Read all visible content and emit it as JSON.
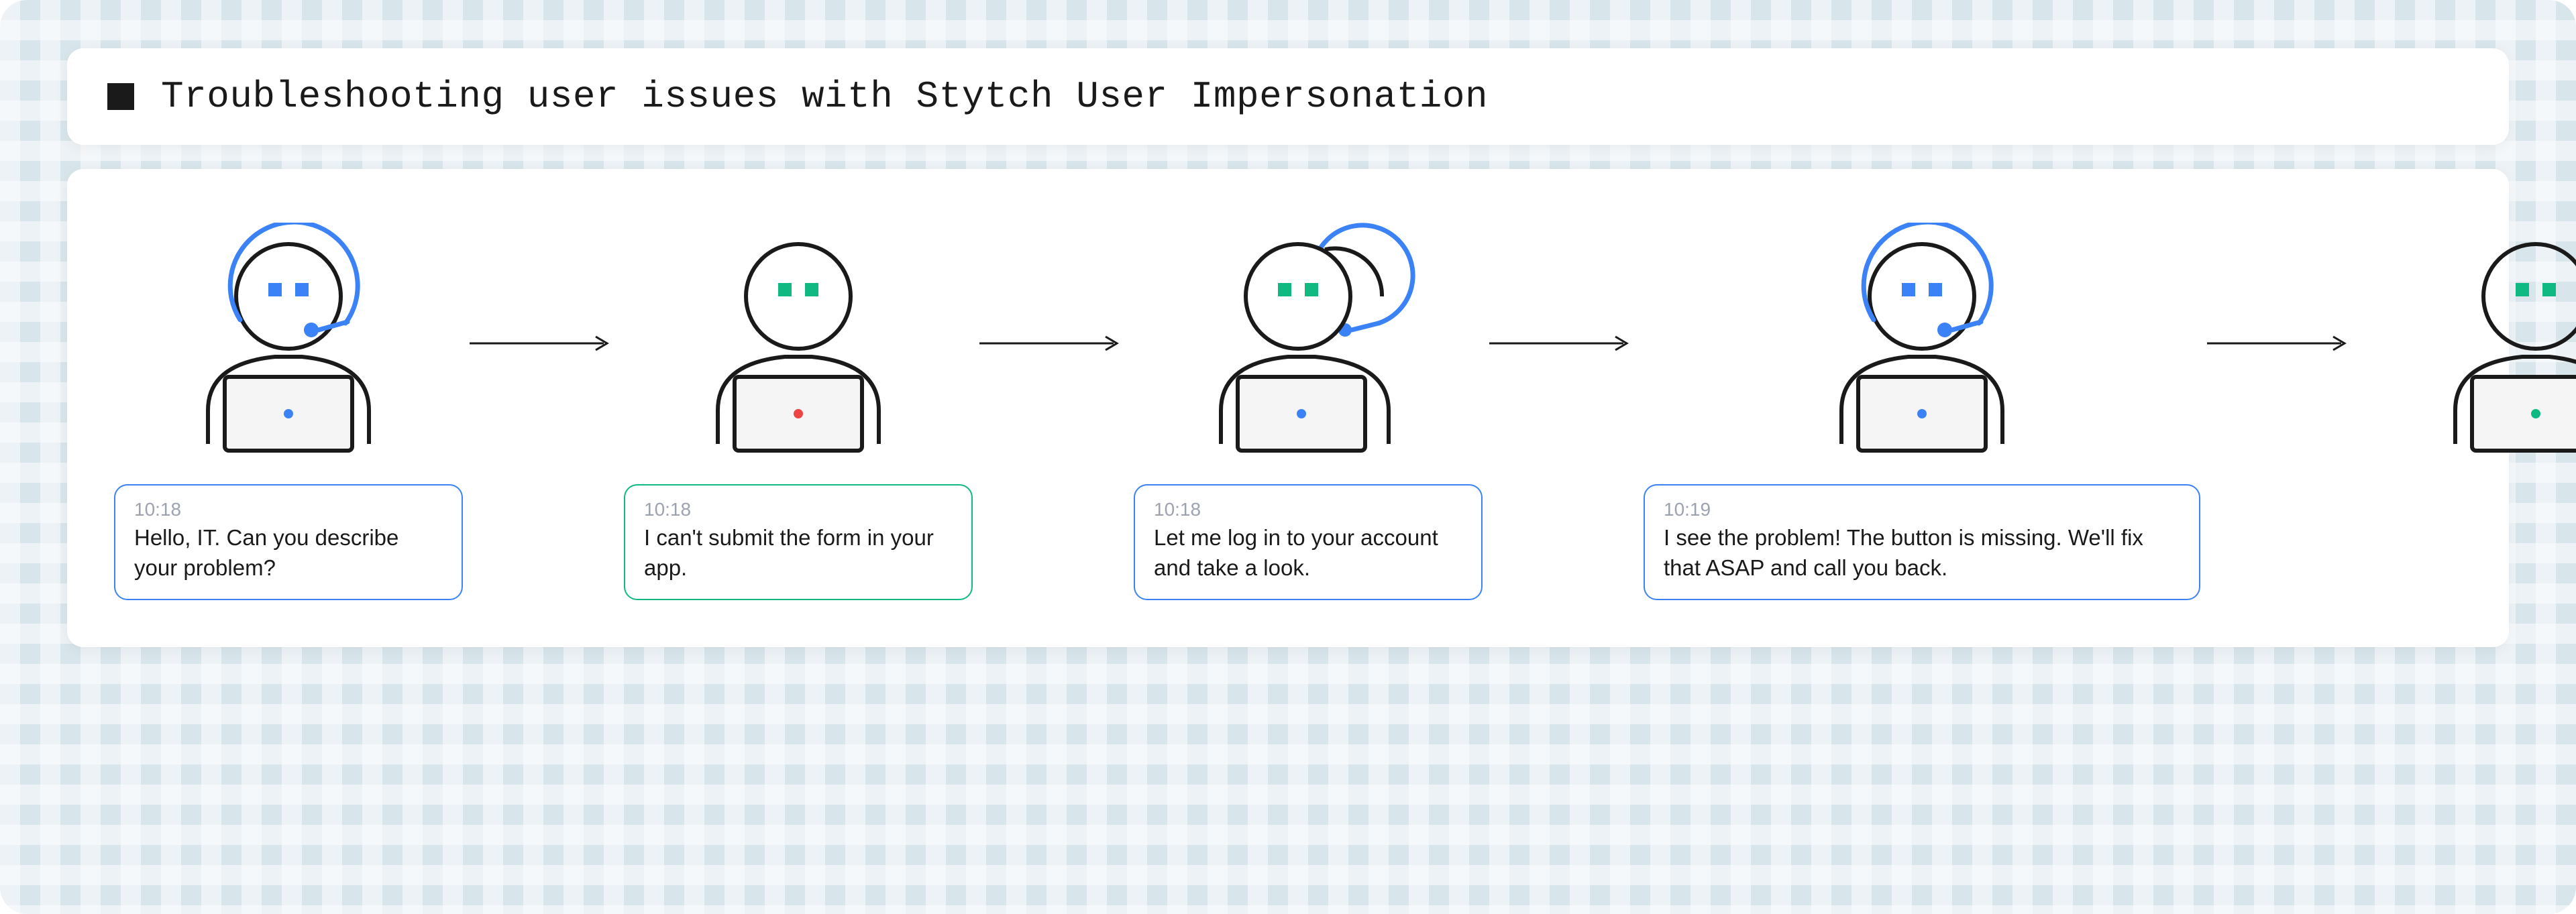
{
  "title": "Troubleshooting user issues with Stytch User Impersonation",
  "colors": {
    "agent_accent": "#3b82f6",
    "user_accent": "#10b981",
    "stroke": "#1a1a1a"
  },
  "steps": [
    {
      "role": "agent",
      "actor": "agent",
      "laptop_dot": "#3b82f6",
      "time": "10:18",
      "text": "Hello, IT. Can you describe your problem?"
    },
    {
      "role": "user",
      "actor": "user",
      "laptop_dot": "#ef4444",
      "time": "10:18",
      "text": "I can't submit the form in your app."
    },
    {
      "role": "agent",
      "actor": "impersonated",
      "laptop_dot": "#3b82f6",
      "time": "10:18",
      "text": "Let me log in to your account and take a look."
    },
    {
      "role": "agent",
      "actor": "agent",
      "laptop_dot": "#3b82f6",
      "time": "10:19",
      "text": "I see the problem! The button is missing. We'll fix that ASAP and call you back.",
      "wide": true
    },
    {
      "role": "user",
      "actor": "user",
      "laptop_dot": "#10b981",
      "time": "",
      "text": "",
      "no_bubble": true
    }
  ]
}
